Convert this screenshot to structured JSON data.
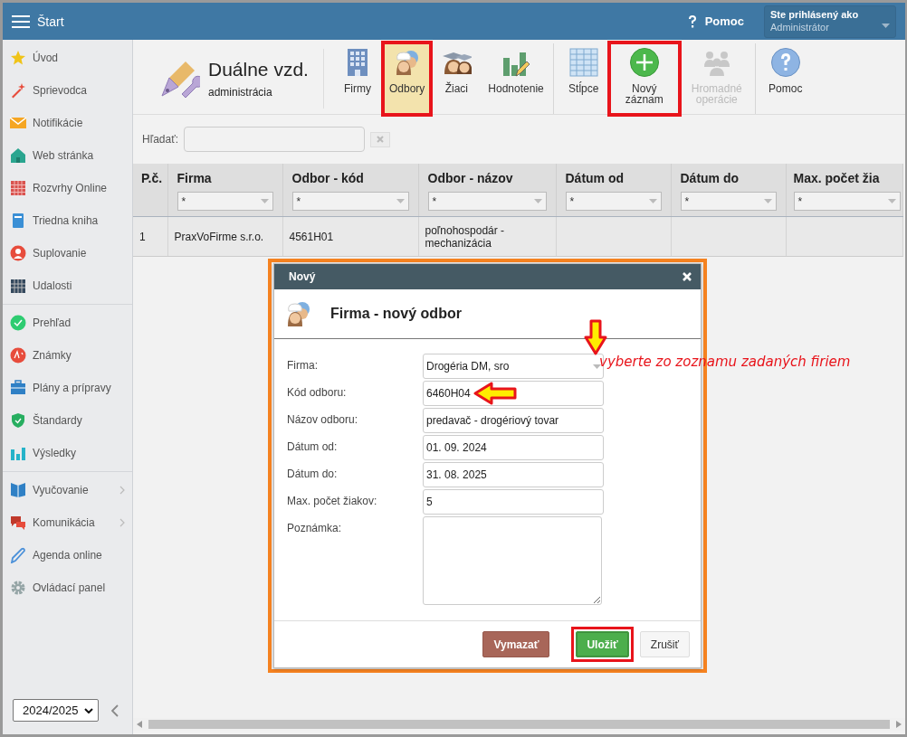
{
  "topbar": {
    "title": "Štart",
    "help": "Pomoc",
    "user_label": "Ste prihlásený ako",
    "user_name": "Administrátor"
  },
  "sidebar": {
    "sections": [
      {
        "items": [
          {
            "label": "Úvod",
            "submenu": false
          },
          {
            "label": "Sprievodca",
            "submenu": false
          },
          {
            "label": "Notifikácie",
            "submenu": false
          },
          {
            "label": "Web stránka",
            "submenu": false
          },
          {
            "label": "Rozvrhy Online",
            "submenu": false
          },
          {
            "label": "Triedna kniha",
            "submenu": false
          },
          {
            "label": "Suplovanie",
            "submenu": false
          },
          {
            "label": "Udalosti",
            "submenu": false
          }
        ]
      },
      {
        "items": [
          {
            "label": "Prehľad",
            "submenu": false
          },
          {
            "label": "Známky",
            "submenu": false
          },
          {
            "label": "Plány a prípravy",
            "submenu": false
          },
          {
            "label": "Štandardy",
            "submenu": false
          },
          {
            "label": "Výsledky",
            "submenu": false
          }
        ]
      },
      {
        "items": [
          {
            "label": "Vyučovanie",
            "submenu": true
          },
          {
            "label": "Komunikácia",
            "submenu": true
          },
          {
            "label": "Agenda online",
            "submenu": false
          },
          {
            "label": "Ovládací panel",
            "submenu": false
          }
        ]
      }
    ],
    "year": "2024/2025"
  },
  "module": {
    "title": "Duálne vzd.",
    "subtitle": "administrácia"
  },
  "toolbar": [
    {
      "label": "Firmy",
      "selected": false,
      "disabled": false,
      "highlighted": false,
      "group_end": false
    },
    {
      "label": "Odbory",
      "selected": true,
      "disabled": false,
      "highlighted": true,
      "group_end": false
    },
    {
      "label": "Žiaci",
      "selected": false,
      "disabled": false,
      "highlighted": false,
      "group_end": false
    },
    {
      "label": "Hodnotenie",
      "selected": false,
      "disabled": false,
      "highlighted": false,
      "group_end": true
    },
    {
      "label": "Stĺpce",
      "selected": false,
      "disabled": false,
      "highlighted": false,
      "group_end": false
    },
    {
      "label": "Nový záznam",
      "selected": false,
      "disabled": false,
      "highlighted": true,
      "group_end": false
    },
    {
      "label": "Hromadné operácie",
      "selected": false,
      "disabled": true,
      "highlighted": false,
      "group_end": true
    },
    {
      "label": "Pomoc",
      "selected": false,
      "disabled": false,
      "highlighted": false,
      "group_end": false
    }
  ],
  "search": {
    "label": "Hľadať:"
  },
  "table": {
    "columns": [
      {
        "title": "P.č."
      },
      {
        "title": "Firma",
        "filter": "*"
      },
      {
        "title": "Odbor - kód",
        "filter": "*"
      },
      {
        "title": "Odbor - názov",
        "filter": "*"
      },
      {
        "title": "Dátum od",
        "filter": "*"
      },
      {
        "title": "Dátum do",
        "filter": "*"
      },
      {
        "title": "Max. počet žia",
        "filter": "*"
      }
    ],
    "rows": [
      [
        "1",
        "PraxVoFirme s.r.o.",
        "4561H01",
        "poľnohospodár - mechanizácia"
      ]
    ]
  },
  "dialog": {
    "title": "Nový",
    "heading": "Firma - nový odbor",
    "fields": [
      {
        "label": "Firma:",
        "kind": "select",
        "value": "Drogéria DM, sro"
      },
      {
        "label": "Kód odboru:",
        "kind": "text",
        "value": "6460H04"
      },
      {
        "label": "Názov odboru:",
        "kind": "text",
        "value": "predavač - drogériový tovar"
      },
      {
        "label": "Dátum od:",
        "kind": "text",
        "value": "01. 09. 2024"
      },
      {
        "label": "Dátum do:",
        "kind": "text",
        "value": "31. 08. 2025"
      },
      {
        "label": "Max. počet žiakov:",
        "kind": "text",
        "value": "5"
      },
      {
        "label": "Poznámka:",
        "kind": "textarea"
      }
    ],
    "buttons": [
      {
        "label": "Vymazať",
        "kind": "danger",
        "highlighted": false
      },
      {
        "label": "Uložiť",
        "kind": "primary",
        "highlighted": true
      },
      {
        "label": "Zrušiť",
        "kind": "default",
        "highlighted": false
      }
    ]
  },
  "annotation": {
    "text": "vyberte zo zoznamu zadaných firiem"
  }
}
